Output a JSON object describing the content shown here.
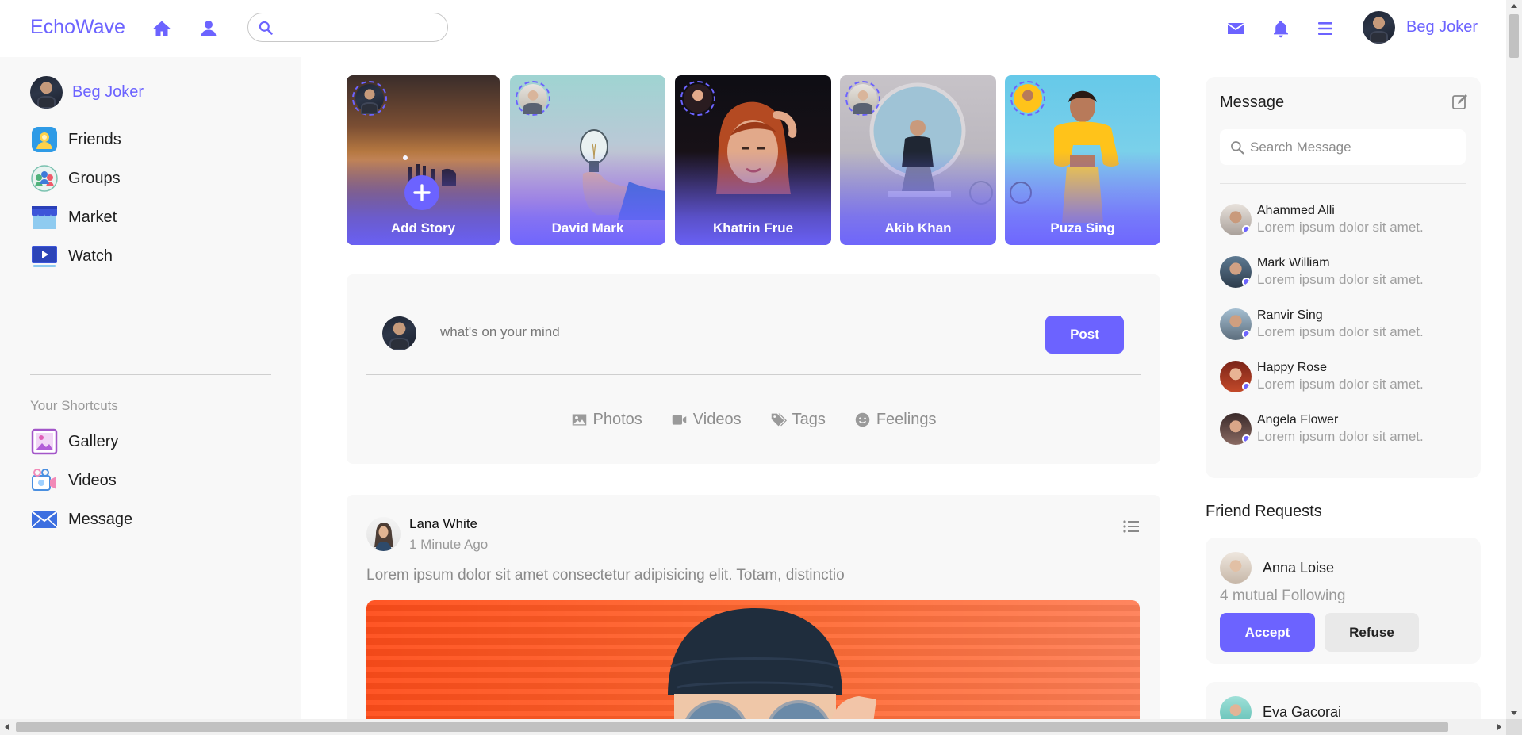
{
  "app": {
    "brand": "EchoWave",
    "accent_color": "#6c63ff",
    "current_user": "Beg Joker"
  },
  "topbar": {
    "icons": [
      "home-icon",
      "user-icon",
      "search-icon",
      "envelope-icon",
      "bell-icon",
      "menu-icon"
    ],
    "search_placeholder": "",
    "user_name": "Beg Joker"
  },
  "sidebar": {
    "profile_name": "Beg Joker",
    "items": [
      {
        "label": "Friends",
        "icon": "friends-icon"
      },
      {
        "label": "Groups",
        "icon": "groups-icon"
      },
      {
        "label": "Market",
        "icon": "market-icon"
      },
      {
        "label": "Watch",
        "icon": "watch-icon"
      }
    ],
    "shortcuts_title": "Your Shortcuts",
    "shortcuts": [
      {
        "label": "Gallery",
        "icon": "gallery-icon"
      },
      {
        "label": "Videos",
        "icon": "videos-icon"
      },
      {
        "label": "Message",
        "icon": "message-icon"
      }
    ]
  },
  "stories": [
    {
      "name": "Add Story",
      "is_add": true
    },
    {
      "name": "David Mark"
    },
    {
      "name": "Khatrin Frue"
    },
    {
      "name": "Akib Khan"
    },
    {
      "name": "Puza Sing"
    }
  ],
  "composer": {
    "placeholder": "what's on your mind",
    "post_label": "Post",
    "actions": [
      {
        "label": "Photos",
        "icon": "image-icon"
      },
      {
        "label": "Videos",
        "icon": "video-camera-icon"
      },
      {
        "label": "Tags",
        "icon": "tags-icon"
      },
      {
        "label": "Feelings",
        "icon": "smile-icon"
      }
    ]
  },
  "post": {
    "author": "Lana White",
    "time": "1 Minute Ago",
    "text": "Lorem ipsum dolor sit amet consectetur adipisicing elit. Totam, distinctio"
  },
  "messages": {
    "title": "Message",
    "search_placeholder": "Search Message",
    "items": [
      {
        "name": "Ahammed Alli",
        "snippet": "Lorem ipsum dolor sit amet."
      },
      {
        "name": "Mark William",
        "snippet": "Lorem ipsum dolor sit amet."
      },
      {
        "name": "Ranvir Sing",
        "snippet": "Lorem ipsum dolor sit amet."
      },
      {
        "name": "Happy Rose",
        "snippet": "Lorem ipsum dolor sit amet."
      },
      {
        "name": "Angela Flower",
        "snippet": "Lorem ipsum dolor sit amet."
      }
    ]
  },
  "friend_requests": {
    "title": "Friend Requests",
    "items": [
      {
        "name": "Anna Loise",
        "mutual": "4 mutual Following",
        "accept_label": "Accept",
        "refuse_label": "Refuse"
      },
      {
        "name": "Eva Gacorai"
      }
    ]
  }
}
